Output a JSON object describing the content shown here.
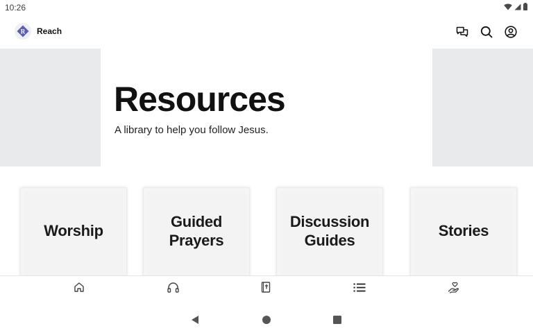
{
  "status_bar": {
    "time": "10:26"
  },
  "app_bar": {
    "title": "Reach",
    "logo_letter": "R"
  },
  "hero": {
    "title": "Resources",
    "subtitle": "A library to help you follow Jesus."
  },
  "cards": [
    {
      "label": "Worship"
    },
    {
      "label": "Guided\nPrayers"
    },
    {
      "label": "Discussion\nGuides"
    },
    {
      "label": "Stories"
    }
  ],
  "bottom_nav": [
    "home-icon",
    "headphones-icon",
    "bible-icon",
    "list-icon",
    "hand-heart-icon"
  ],
  "colors": {
    "logo_accent": "#5b5fb0",
    "hero_block": "#e9eaec",
    "card_bg": "#f5f5f5"
  }
}
